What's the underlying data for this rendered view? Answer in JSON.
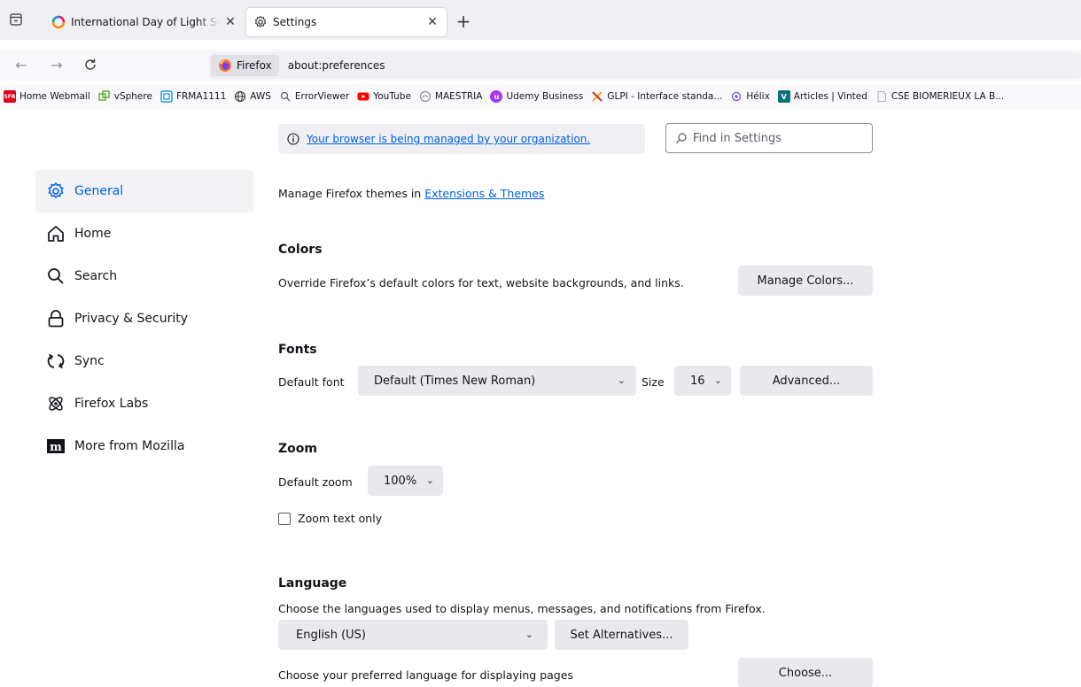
{
  "tabs": [
    {
      "title": "International Day of Light School",
      "icon": "firefox-circle-icon"
    },
    {
      "title": "Settings",
      "icon": "gear-icon"
    }
  ],
  "toolbar": {
    "identity_label": "Firefox",
    "url": "about:preferences"
  },
  "bookmarks": [
    {
      "label": "Home Webmail",
      "badge": "SFR",
      "color": "#e2001a"
    },
    {
      "label": "vSphere",
      "badge": "",
      "color": "#6cb33f"
    },
    {
      "label": "FRMA1111",
      "badge": "",
      "color": "#1a9bd7"
    },
    {
      "label": "AWS",
      "badge": "",
      "color": "#5b5b66"
    },
    {
      "label": "ErrorViewer",
      "badge": "",
      "color": "#5b5b66"
    },
    {
      "label": "YouTube",
      "badge": "",
      "color": "#ff0000"
    },
    {
      "label": "MAESTRIA",
      "badge": "",
      "color": "#8f8f9d"
    },
    {
      "label": "Udemy Business",
      "badge": "",
      "color": "#a435f0"
    },
    {
      "label": "GLPI - Interface standa...",
      "badge": "",
      "color": "#f5a623"
    },
    {
      "label": "Hélix",
      "badge": "",
      "color": "#7b4fc9"
    },
    {
      "label": "Articles | Vinted",
      "badge": "V",
      "color": "#09717b"
    },
    {
      "label": "CSE BIOMERIEUX LA B...",
      "badge": "",
      "color": "#b0b0b8"
    }
  ],
  "managed_notice": "Your browser is being managed by your organization.",
  "search": {
    "placeholder": "Find in Settings"
  },
  "sidebar": {
    "items": [
      {
        "label": "General",
        "icon": "gear-icon"
      },
      {
        "label": "Home",
        "icon": "home-icon"
      },
      {
        "label": "Search",
        "icon": "search-icon"
      },
      {
        "label": "Privacy & Security",
        "icon": "lock-icon"
      },
      {
        "label": "Sync",
        "icon": "sync-icon"
      },
      {
        "label": "Firefox Labs",
        "icon": "atom-icon"
      },
      {
        "label": "More from Mozilla",
        "icon": "mozilla-m-icon"
      }
    ]
  },
  "themes": {
    "text": "Manage Firefox themes in ",
    "link": "Extensions & Themes"
  },
  "colors": {
    "heading": "Colors",
    "description": "Override Firefox’s default colors for text, website backgrounds, and links.",
    "button": "Manage Colors..."
  },
  "fonts": {
    "heading": "Fonts",
    "default_font_label": "Default font",
    "default_font_value": "Default (Times New Roman)",
    "size_label": "Size",
    "size_value": "16",
    "advanced_button": "Advanced..."
  },
  "zoom": {
    "heading": "Zoom",
    "default_zoom_label": "Default zoom",
    "default_zoom_value": "100%",
    "zoom_text_only": "Zoom text only"
  },
  "language": {
    "heading": "Language",
    "description": "Choose the languages used to display menus, messages, and notifications from Firefox.",
    "selected": "English (US)",
    "alternatives_button": "Set Alternatives...",
    "pages_description": "Choose your preferred language for displaying pages",
    "choose_button": "Choose..."
  },
  "colors_theme": {
    "accent": "#0061e0",
    "button_bg": "#e9e9ed",
    "tabbar_bg": "#f0f0f4"
  }
}
